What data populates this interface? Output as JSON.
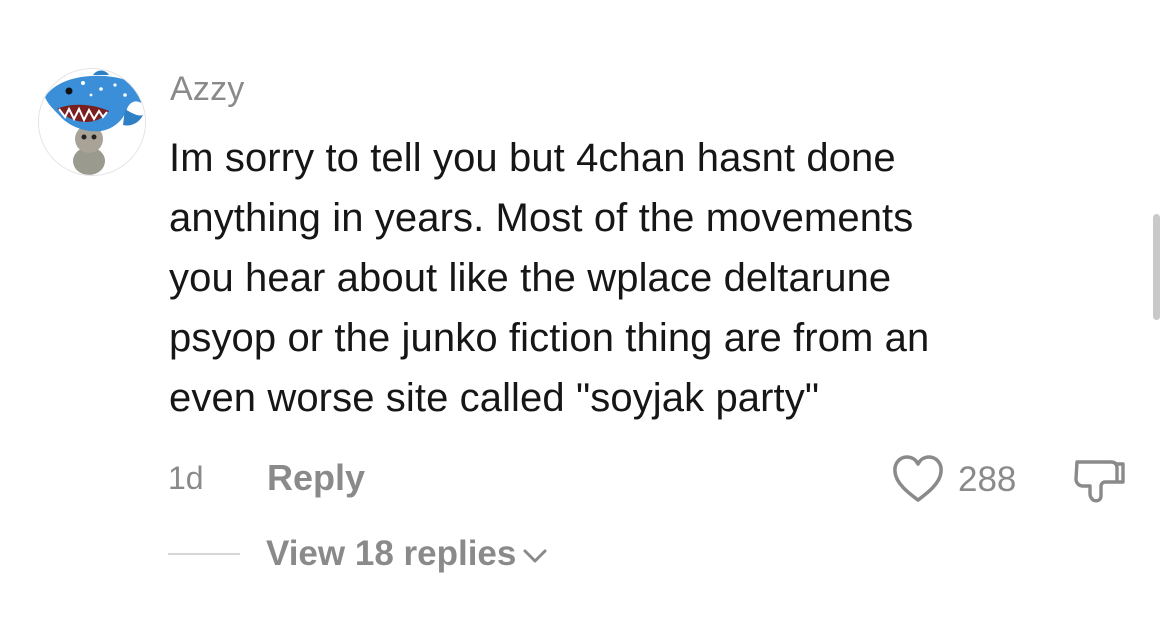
{
  "comment": {
    "username": "Azzy",
    "text_lines": [
      "Im sorry to tell you but 4chan hasnt done",
      "anything in years. Most of the movements",
      "you hear about like the wplace deltarune",
      "psyop or the junko fiction thing are from an",
      "even worse site called \"soyjak party\""
    ],
    "timestamp": "1d",
    "reply_label": "Reply",
    "like_count": "288",
    "view_replies_label": "View 18 replies"
  },
  "icons": {
    "avatar": "shark-avatar",
    "like": "heart-icon",
    "dislike": "thumbs-down-icon",
    "expand": "chevron-down-icon"
  },
  "colors": {
    "text": "#161616",
    "muted": "#8a8a8a",
    "background": "#ffffff"
  }
}
